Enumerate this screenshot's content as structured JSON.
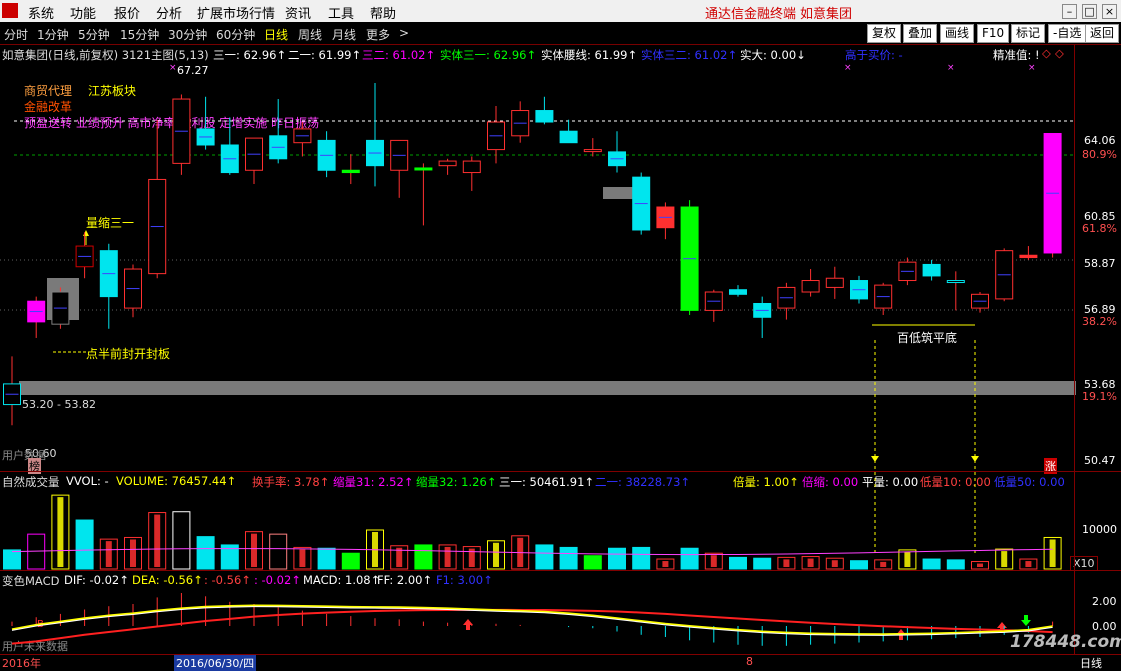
{
  "menu": {
    "items": [
      "系统",
      "功能",
      "报价",
      "分析",
      "扩展市场行情",
      "资讯",
      "工具",
      "帮助"
    ],
    "brand": "通达信金融终端",
    "stock_brand": "如意集团"
  },
  "toolbar": {
    "periods": [
      "分时",
      "1分钟",
      "5分钟",
      "15分钟",
      "30分钟",
      "60分钟",
      "日线",
      "周线",
      "月线",
      "更多"
    ],
    "active": "日线",
    "more_arrow": ">",
    "buttons": [
      "复权",
      "叠加",
      "画线",
      "F10",
      "标记",
      "-自选",
      "返回"
    ]
  },
  "main_info": {
    "title": "如意集团(日线,前复权) 3121主图(5,13)",
    "items": [
      {
        "text": "三一: 62.96↑",
        "color": "#ffffff"
      },
      {
        "text": "二一: 61.99↑",
        "color": "#ffffff"
      },
      {
        "text": "三二: 61.02↑",
        "color": "#ff00ff"
      },
      {
        "text": "实体三一: 62.96↑",
        "color": "#00ff00"
      },
      {
        "text": "实体腰线: 61.99↑",
        "color": "#ffffff"
      },
      {
        "text": "实体三二: 61.02↑",
        "color": "#3030ff"
      },
      {
        "text": "实大: 0.00↓",
        "color": "#ffffff"
      },
      {
        "text": "高于买价: -",
        "color": "#3030ff"
      }
    ],
    "precision": "精准值: !"
  },
  "annotations": {
    "tags1": [
      "商贸代理",
      "江苏板块"
    ],
    "tag2": "金融改革",
    "tags3": "预盈送转 业绩预升 高市净率 微利股 定增实施 昨日振荡",
    "high_label": "67.27",
    "vol_shrink": "量缩三一",
    "half_board": "点半前封开封板",
    "low_flat": "百低筑平底",
    "low_range": "53.20 - 53.82",
    "buy_marker": "50.60",
    "bang": "榜",
    "zhang": "涨",
    "user_data": "用户数据"
  },
  "y_axis_main": [
    {
      "text": "64.06",
      "color": "#ffffff"
    },
    {
      "text": "80.9%",
      "color": "#ff5050"
    },
    {
      "text": "60.85",
      "color": "#ffffff"
    },
    {
      "text": "61.8%",
      "color": "#ff5050"
    },
    {
      "text": "58.87",
      "color": "#ffffff"
    },
    {
      "text": "56.89",
      "color": "#ffffff"
    },
    {
      "text": "38.2%",
      "color": "#ff5050"
    },
    {
      "text": "53.68",
      "color": "#ffffff"
    },
    {
      "text": "19.1%",
      "color": "#ff5050"
    },
    {
      "text": "50.47",
      "color": "#ffffff"
    }
  ],
  "vol_info": {
    "title": "自然成交量",
    "items": [
      {
        "text": "VVOL: -",
        "color": "#ffffff"
      },
      {
        "text": "VOLUME: 76457.44↑",
        "color": "#ffff00"
      },
      {
        "text": "换手率: 3.78↑",
        "color": "#ff4040"
      },
      {
        "text": "缩量31: 2.52↑",
        "color": "#ff00ff"
      },
      {
        "text": "缩量32: 1.26↑",
        "color": "#00ff00"
      },
      {
        "text": "三一: 50461.91↑",
        "color": "#ffffff"
      },
      {
        "text": "二一: 38228.73↑",
        "color": "#3030ff"
      },
      {
        "text": "倍量: 1.00↑",
        "color": "#ffff00"
      },
      {
        "text": "倍缩: 0.00",
        "color": "#ff00ff"
      },
      {
        "text": "平量: 0.00",
        "color": "#ffffff"
      },
      {
        "text": "低量10: 0.00",
        "color": "#ff4040"
      },
      {
        "text": "低量50: 0.00",
        "color": "#3030ff"
      }
    ],
    "y_label": "10000",
    "x_label": "X10"
  },
  "macd_info": {
    "title": "变色MACD",
    "items": [
      {
        "text": "DIF: -0.02↑",
        "color": "#ffffff"
      },
      {
        "text": "DEA: -0.56↑",
        "color": "#ffff00"
      },
      {
        "text": ": -0.56↑",
        "color": "#ff4040"
      },
      {
        "text": ": -0.02↑",
        "color": "#ff00ff"
      },
      {
        "text": "MACD: 1.08↑",
        "color": "#ffffff"
      },
      {
        "text": "FF: 2.00↑",
        "color": "#ffffff"
      },
      {
        "text": "F1: 3.00↑",
        "color": "#3030ff"
      }
    ],
    "y_labels": [
      "2.00",
      "0.00"
    ],
    "user_data": "用户未来数据"
  },
  "bottom": {
    "year": "2016年",
    "date_highlight": "2016/06/30/四",
    "mark_8": "8",
    "period": "日线",
    "watermark": "178448.com"
  },
  "chart_data": {
    "type": "candlestick",
    "price_range": [
      50.0,
      67.5
    ],
    "candles": [
      {
        "o": 52.5,
        "h": 54.6,
        "l": 51.6,
        "c": 53.4,
        "color": "#00e5ee"
      },
      {
        "o": 56.1,
        "h": 57.2,
        "l": 55.4,
        "c": 57.0,
        "color": "#ff00ff"
      },
      {
        "o": 56.0,
        "h": 57.6,
        "l": 55.8,
        "c": 57.4,
        "color": "#808080"
      },
      {
        "o": 58.5,
        "h": 60.0,
        "l": 58.0,
        "c": 59.4,
        "color": "#d00000"
      },
      {
        "o": 59.2,
        "h": 59.5,
        "l": 55.8,
        "c": 57.2,
        "color": "#00e5ee"
      },
      {
        "o": 56.7,
        "h": 58.6,
        "l": 56.3,
        "c": 58.4,
        "color": "#ff3030"
      },
      {
        "o": 58.2,
        "h": 64.9,
        "l": 58.0,
        "c": 62.3,
        "color": "#ff3030"
      },
      {
        "o": 63.0,
        "h": 66.0,
        "l": 62.5,
        "c": 65.8,
        "color": "#ff3030"
      },
      {
        "o": 64.5,
        "h": 65.9,
        "l": 63.6,
        "c": 63.8,
        "color": "#00e5ee"
      },
      {
        "o": 63.8,
        "h": 65.0,
        "l": 62.5,
        "c": 62.6,
        "color": "#00e5ee"
      },
      {
        "o": 62.7,
        "h": 64.0,
        "l": 62.1,
        "c": 64.1,
        "color": "#ff3030"
      },
      {
        "o": 64.2,
        "h": 65.8,
        "l": 63.0,
        "c": 63.2,
        "color": "#00e5ee"
      },
      {
        "o": 63.9,
        "h": 64.8,
        "l": 63.3,
        "c": 64.5,
        "color": "#ff3030"
      },
      {
        "o": 64.0,
        "h": 64.4,
        "l": 62.4,
        "c": 62.7,
        "color": "#00e5ee"
      },
      {
        "o": 62.6,
        "h": 63.4,
        "l": 62.1,
        "c": 62.7,
        "color": "#00ff00"
      },
      {
        "o": 64.0,
        "h": 66.5,
        "l": 62.0,
        "c": 62.9,
        "color": "#00e5ee"
      },
      {
        "o": 62.7,
        "h": 64.0,
        "l": 61.5,
        "c": 64.0,
        "color": "#ff3030"
      },
      {
        "o": 62.8,
        "h": 63.0,
        "l": 60.3,
        "c": 62.8,
        "color": "#00ff00"
      },
      {
        "o": 62.9,
        "h": 63.2,
        "l": 62.5,
        "c": 63.1,
        "color": "#ff3030"
      },
      {
        "o": 62.6,
        "h": 63.3,
        "l": 61.8,
        "c": 63.1,
        "color": "#ff3030"
      },
      {
        "o": 63.6,
        "h": 65.5,
        "l": 63.0,
        "c": 64.8,
        "color": "#ff3030"
      },
      {
        "o": 64.2,
        "h": 65.7,
        "l": 63.9,
        "c": 65.3,
        "color": "#ff3030"
      },
      {
        "o": 65.3,
        "h": 65.9,
        "l": 64.7,
        "c": 64.8,
        "color": "#00e5ee"
      },
      {
        "o": 64.4,
        "h": 64.9,
        "l": 63.9,
        "c": 63.9,
        "color": "#00e5ee"
      },
      {
        "o": 63.6,
        "h": 64.1,
        "l": 63.3,
        "c": 63.6,
        "color": "#ff3030"
      },
      {
        "o": 63.5,
        "h": 64.4,
        "l": 62.6,
        "c": 62.9,
        "color": "#00e5ee"
      },
      {
        "o": 62.4,
        "h": 62.6,
        "l": 59.9,
        "c": 60.1,
        "color": "#00e5ee"
      },
      {
        "o": 61.1,
        "h": 61.3,
        "l": 59.7,
        "c": 60.2,
        "color": "#ff3030"
      },
      {
        "o": 61.1,
        "h": 61.4,
        "l": 56.4,
        "c": 56.6,
        "color": "#00ff00"
      },
      {
        "o": 56.6,
        "h": 57.5,
        "l": 56.1,
        "c": 57.4,
        "color": "#ff3030"
      },
      {
        "o": 57.5,
        "h": 57.7,
        "l": 57.2,
        "c": 57.3,
        "color": "#00e5ee"
      },
      {
        "o": 56.9,
        "h": 57.2,
        "l": 55.4,
        "c": 56.3,
        "color": "#00e5ee"
      },
      {
        "o": 56.7,
        "h": 57.8,
        "l": 56.2,
        "c": 57.6,
        "color": "#ff3030"
      },
      {
        "o": 57.4,
        "h": 58.4,
        "l": 57.2,
        "c": 57.9,
        "color": "#ff3030"
      },
      {
        "o": 57.6,
        "h": 58.5,
        "l": 57.1,
        "c": 58.0,
        "color": "#ff3030"
      },
      {
        "o": 57.9,
        "h": 58.1,
        "l": 56.9,
        "c": 57.1,
        "color": "#00e5ee"
      },
      {
        "o": 56.7,
        "h": 57.8,
        "l": 56.4,
        "c": 57.7,
        "color": "#ff3030"
      },
      {
        "o": 57.9,
        "h": 58.9,
        "l": 57.7,
        "c": 58.7,
        "color": "#ff3030"
      },
      {
        "o": 58.6,
        "h": 58.8,
        "l": 57.9,
        "c": 58.1,
        "color": "#00e5ee"
      },
      {
        "o": 57.9,
        "h": 58.3,
        "l": 56.6,
        "c": 57.9,
        "color": "#00e5ee"
      },
      {
        "o": 56.7,
        "h": 57.4,
        "l": 56.5,
        "c": 57.3,
        "color": "#ff3030"
      },
      {
        "o": 57.1,
        "h": 59.3,
        "l": 57.0,
        "c": 59.2,
        "color": "#ff3030"
      },
      {
        "o": 59.0,
        "h": 59.4,
        "l": 58.8,
        "c": 58.9,
        "color": "#ff3030"
      },
      {
        "o": 59.1,
        "h": 64.3,
        "l": 58.9,
        "c": 64.3,
        "color": "#ff00ff"
      }
    ],
    "volume": [
      {
        "v": 2.3,
        "color": "#00e5ee"
      },
      {
        "v": 4.2,
        "color": "#ff00ff"
      },
      {
        "v": 8.9,
        "color": "#ffff00"
      },
      {
        "v": 5.9,
        "color": "#00e5ee"
      },
      {
        "v": 3.6,
        "color": "#ff3030"
      },
      {
        "v": 3.8,
        "color": "#ff3030"
      },
      {
        "v": 6.8,
        "color": "#ff3030"
      },
      {
        "v": 6.9,
        "color": "#ffffff"
      },
      {
        "v": 3.9,
        "color": "#00e5ee"
      },
      {
        "v": 2.9,
        "color": "#00e5ee"
      },
      {
        "v": 4.5,
        "color": "#ff3030"
      },
      {
        "v": 4.2,
        "color": "#ff8080"
      },
      {
        "v": 2.6,
        "color": "#ff3030"
      },
      {
        "v": 2.5,
        "color": "#00e5ee"
      },
      {
        "v": 1.9,
        "color": "#00ff00"
      },
      {
        "v": 4.7,
        "color": "#ffff00"
      },
      {
        "v": 2.8,
        "color": "#ff3030"
      },
      {
        "v": 2.9,
        "color": "#00ff00"
      },
      {
        "v": 2.9,
        "color": "#ff3030"
      },
      {
        "v": 2.7,
        "color": "#ff3030"
      },
      {
        "v": 3.4,
        "color": "#ffff00"
      },
      {
        "v": 4.0,
        "color": "#ff3030"
      },
      {
        "v": 2.9,
        "color": "#00e5ee"
      },
      {
        "v": 2.6,
        "color": "#00e5ee"
      },
      {
        "v": 1.6,
        "color": "#00ff00"
      },
      {
        "v": 2.5,
        "color": "#00e5ee"
      },
      {
        "v": 2.6,
        "color": "#00e5ee"
      },
      {
        "v": 1.2,
        "color": "#ff3030"
      },
      {
        "v": 2.5,
        "color": "#00e5ee"
      },
      {
        "v": 1.9,
        "color": "#ff3030"
      },
      {
        "v": 1.4,
        "color": "#00e5ee"
      },
      {
        "v": 1.3,
        "color": "#00e5ee"
      },
      {
        "v": 1.4,
        "color": "#ff3030"
      },
      {
        "v": 1.5,
        "color": "#ff3030"
      },
      {
        "v": 1.3,
        "color": "#ff3030"
      },
      {
        "v": 1.0,
        "color": "#00e5ee"
      },
      {
        "v": 1.1,
        "color": "#ff3030"
      },
      {
        "v": 2.3,
        "color": "#ffff00"
      },
      {
        "v": 1.2,
        "color": "#00e5ee"
      },
      {
        "v": 1.1,
        "color": "#00e5ee"
      },
      {
        "v": 0.9,
        "color": "#ff3030"
      },
      {
        "v": 2.4,
        "color": "#ffff00"
      },
      {
        "v": 1.2,
        "color": "#ff3030"
      },
      {
        "v": 3.8,
        "color": "#ffff00"
      }
    ],
    "macd": [
      0.4,
      0.8,
      1.1,
      1.5,
      1.8,
      2.0,
      2.6,
      3.0,
      2.7,
      2.2,
      2.0,
      1.7,
      1.4,
      1.1,
      0.9,
      0.7,
      0.6,
      0.4,
      0.3,
      0.2,
      0.2,
      0.1,
      0.0,
      -0.1,
      -0.2,
      -0.5,
      -0.8,
      -1.0,
      -1.3,
      -1.5,
      -1.7,
      -1.8,
      -1.8,
      -1.7,
      -1.6,
      -1.5,
      -1.4,
      -1.3,
      -1.2,
      -1.1,
      -1.0,
      -0.8,
      -0.6,
      0.4
    ],
    "dif": [
      -0.3,
      0.1,
      0.4,
      0.7,
      0.95,
      1.15,
      1.4,
      1.6,
      1.75,
      1.82,
      1.86,
      1.85,
      1.82,
      1.78,
      1.74,
      1.72,
      1.7,
      1.66,
      1.6,
      1.52,
      1.44,
      1.38,
      1.3,
      1.15,
      0.95,
      0.7,
      0.45,
      0.2,
      0.0,
      -0.18,
      -0.35,
      -0.5,
      -0.6,
      -0.68,
      -0.72,
      -0.74,
      -0.75,
      -0.72,
      -0.68,
      -0.62,
      -0.55,
      -0.48,
      -0.35,
      -0.02
    ],
    "dea": [
      -1.6,
      -1.4,
      -1.1,
      -0.8,
      -0.55,
      -0.3,
      -0.05,
      0.2,
      0.45,
      0.65,
      0.85,
      1.0,
      1.12,
      1.22,
      1.3,
      1.36,
      1.41,
      1.44,
      1.46,
      1.47,
      1.47,
      1.46,
      1.45,
      1.42,
      1.38,
      1.32,
      1.22,
      1.1,
      0.96,
      0.82,
      0.68,
      0.55,
      0.42,
      0.3,
      0.18,
      0.08,
      -0.02,
      -0.1,
      -0.18,
      -0.26,
      -0.32,
      -0.38,
      -0.46,
      -0.56
    ]
  }
}
